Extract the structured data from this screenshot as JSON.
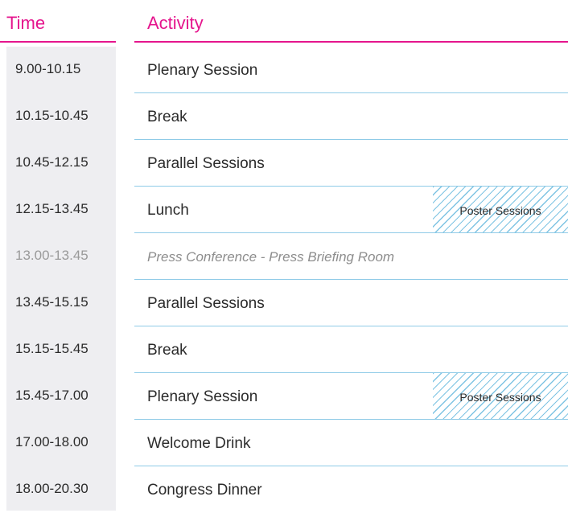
{
  "header": {
    "time_label": "Time",
    "activity_label": "Activity"
  },
  "schedule": [
    {
      "time": "9.00-10.15",
      "activity": "Plenary Session",
      "poster": ""
    },
    {
      "time": "10.15-10.45",
      "activity": "Break",
      "poster": ""
    },
    {
      "time": "10.45-12.15",
      "activity": "Parallel Sessions",
      "poster": ""
    },
    {
      "time": "12.15-13.45",
      "activity": "Lunch",
      "poster": "Poster Sessions"
    },
    {
      "time": "13.00-13.45",
      "activity": "Press Conference - Press Briefing Room",
      "poster": ""
    },
    {
      "time": "13.45-15.15",
      "activity": "Parallel Sessions",
      "poster": ""
    },
    {
      "time": "15.15-15.45",
      "activity": "Break",
      "poster": ""
    },
    {
      "time": "15.45-17.00",
      "activity": "Plenary Session",
      "poster": "Poster Sessions"
    },
    {
      "time": "17.00-18.00",
      "activity": "Welcome Drink",
      "poster": ""
    },
    {
      "time": "18.00-20.30",
      "activity": "Congress Dinner",
      "poster": ""
    }
  ],
  "colors": {
    "accent": "#e5158d",
    "separator": "#8fcbe7",
    "time_column_bg": "#eeeef1",
    "text": "#2b2b2b",
    "muted_text": "#9a9a9a"
  }
}
